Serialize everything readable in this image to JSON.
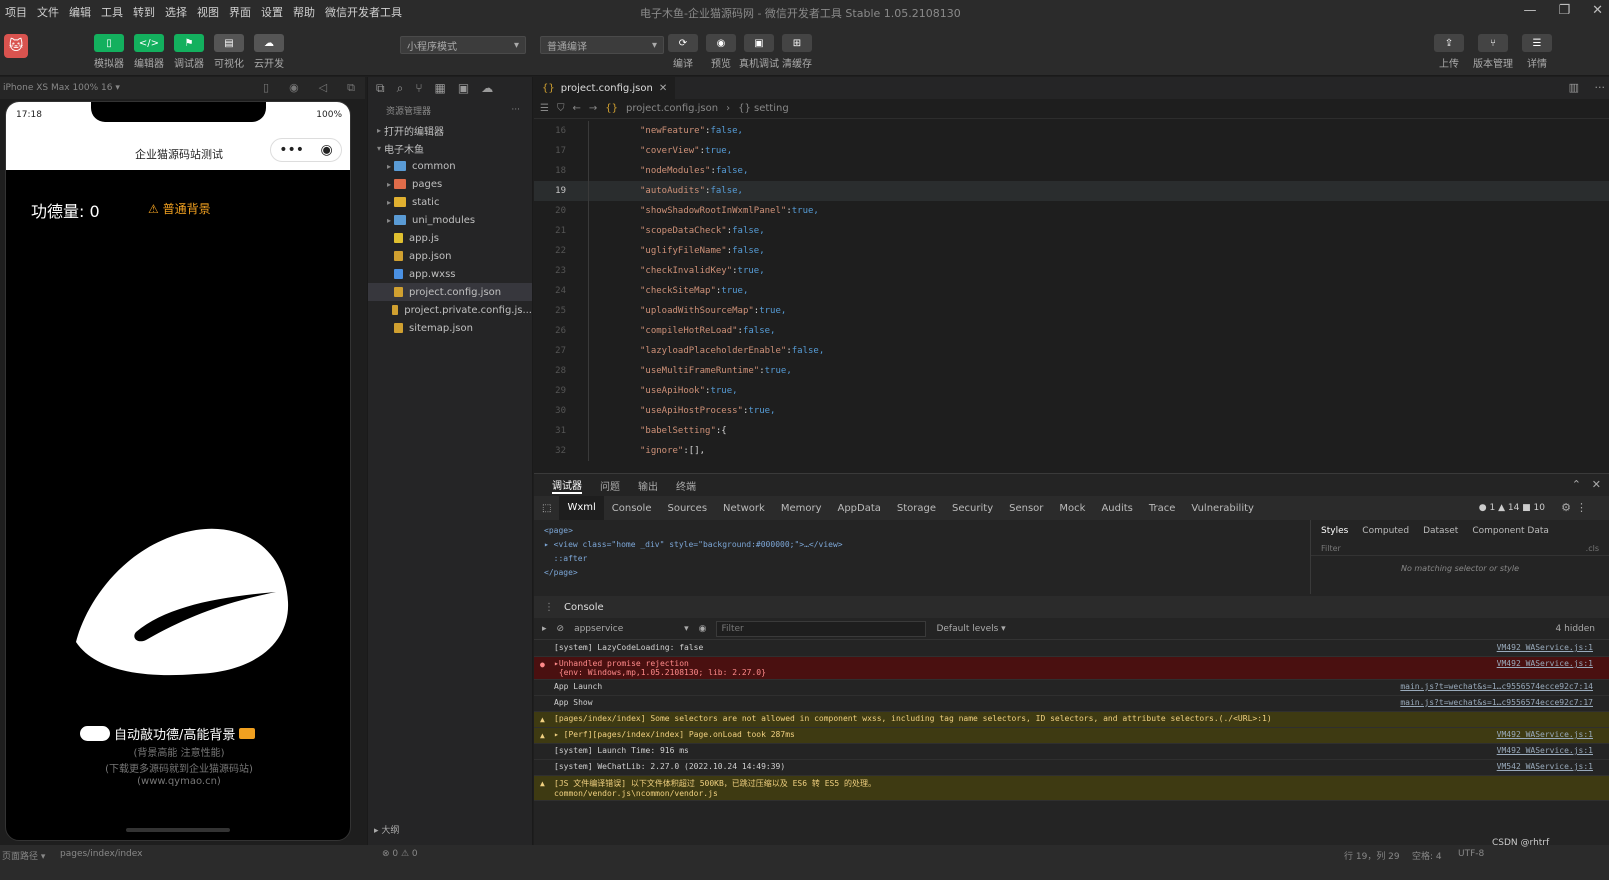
{
  "menubar": {
    "items": [
      "项目",
      "文件",
      "编辑",
      "工具",
      "转到",
      "选择",
      "视图",
      "界面",
      "设置",
      "帮助",
      "微信开发者工具"
    ],
    "window_title": "电子木鱼-企业猫源码网 - 微信开发者工具 Stable 1.05.2108130"
  },
  "toolbar": {
    "left_buttons": [
      {
        "label": "模拟器",
        "color": "#13b05e"
      },
      {
        "label": "编辑器",
        "color": "#13b05e"
      },
      {
        "label": "调试器",
        "color": "#13b05e"
      },
      {
        "label": "可视化",
        "color": "#555555"
      },
      {
        "label": "云开发",
        "color": "#555555"
      }
    ],
    "mode_select": "小程序模式",
    "compile_select": "普通编译",
    "mid_buttons": [
      "编译",
      "预览",
      "真机调试",
      "清缓存"
    ],
    "right_buttons": [
      "上传",
      "版本管理",
      "详情"
    ]
  },
  "simulator": {
    "device": "iPhone XS Max 100% 16 ▾",
    "time": "17:18",
    "battery": "100%",
    "page_title": "企业猫源码站测试",
    "merit": "功德量: 0",
    "warn_button": "⚠ 普通背景",
    "toggle_label": "自动敲功德/高能背景",
    "hints": [
      "(背景高能 注意性能)",
      "(下载更多源码就到企业猫源码站)",
      "(www.qymao.cn)"
    ]
  },
  "explorer": {
    "header": "资源管理器",
    "open_editors": "打开的编辑器",
    "project": "电子木鱼",
    "items": [
      {
        "name": "common",
        "type": "folder",
        "color": "#5a9bd5"
      },
      {
        "name": "pages",
        "type": "folder",
        "color": "#e06c4a"
      },
      {
        "name": "static",
        "type": "folder",
        "color": "#e0b030"
      },
      {
        "name": "uni_modules",
        "type": "folder",
        "color": "#5a9bd5"
      },
      {
        "name": "app.js",
        "type": "file",
        "color": "#e0c030"
      },
      {
        "name": "app.json",
        "type": "file",
        "color": "#d0a030"
      },
      {
        "name": "app.wxss",
        "type": "file",
        "color": "#4a90e2"
      },
      {
        "name": "project.config.json",
        "type": "file",
        "color": "#d0a030"
      },
      {
        "name": "project.private.config.js...",
        "type": "file",
        "color": "#d0a030"
      },
      {
        "name": "sitemap.json",
        "type": "file",
        "color": "#d0a030"
      }
    ],
    "outline": "大纲"
  },
  "editor": {
    "tab": "project.config.json",
    "breadcrumb": [
      "project.config.json",
      "{} setting"
    ],
    "lines": [
      {
        "n": "16",
        "key": "newFeature",
        "val": "false"
      },
      {
        "n": "17",
        "key": "coverView",
        "val": "true"
      },
      {
        "n": "18",
        "key": "nodeModules",
        "val": "false"
      },
      {
        "n": "19",
        "key": "autoAudits",
        "val": "false"
      },
      {
        "n": "20",
        "key": "showShadowRootInWxmlPanel",
        "val": "true"
      },
      {
        "n": "21",
        "key": "scopeDataCheck",
        "val": "false"
      },
      {
        "n": "22",
        "key": "uglifyFileName",
        "val": "false"
      },
      {
        "n": "23",
        "key": "checkInvalidKey",
        "val": "true"
      },
      {
        "n": "24",
        "key": "checkSiteMap",
        "val": "true"
      },
      {
        "n": "25",
        "key": "uploadWithSourceMap",
        "val": "true"
      },
      {
        "n": "26",
        "key": "compileHotReLoad",
        "val": "false"
      },
      {
        "n": "27",
        "key": "lazyloadPlaceholderEnable",
        "val": "false"
      },
      {
        "n": "28",
        "key": "useMultiFrameRuntime",
        "val": "true"
      },
      {
        "n": "29",
        "key": "useApiHook",
        "val": "true"
      },
      {
        "n": "30",
        "key": "useApiHostProcess",
        "val": "true"
      },
      {
        "n": "31",
        "key": "babelSetting",
        "val": "{"
      },
      {
        "n": "32",
        "key": "ignore",
        "val": "[],"
      }
    ]
  },
  "devtools": {
    "top_tabs": [
      "调试器",
      "问题",
      "输出",
      "终端"
    ],
    "tabs": [
      "Wxml",
      "Console",
      "Sources",
      "Network",
      "Memory",
      "AppData",
      "Storage",
      "Security",
      "Sensor",
      "Mock",
      "Audits",
      "Trace",
      "Vulnerability"
    ],
    "counts": "● 1 ▲ 14 ■ 10",
    "wxml_lines": [
      "<page>",
      "▸ <view class=\"home _div\" style=\"background:#000000;\">…</view>",
      "  ::after",
      "</page>"
    ],
    "style_tabs": [
      "Styles",
      "Computed",
      "Dataset",
      "Component Data"
    ],
    "style_filter": "Filter",
    "style_cls": ".cls",
    "no_match": "No matching selector or style",
    "console_label": "Console",
    "context": "appservice",
    "filter_placeholder": "Filter",
    "levels": "Default levels ▾",
    "hidden": "4 hidden",
    "logs": [
      {
        "type": "info",
        "msg": "[system] LazyCodeLoading: false",
        "src": "VM492 WAService.js:1"
      },
      {
        "type": "err",
        "msg": "▸Unhandled promise rejection\n {env: Windows,mp,1.05.2108130; lib: 2.27.0}",
        "src": "VM492 WAService.js:1"
      },
      {
        "type": "info",
        "msg": "App Launch",
        "src": "main.js?t=wechat&s=1…c9556574ecce92c7:14"
      },
      {
        "type": "info",
        "msg": "App Show",
        "src": "main.js?t=wechat&s=1…c9556574ecce92c7:17"
      },
      {
        "type": "warn",
        "msg": "[pages/index/index] Some selectors are not allowed in component wxss, including tag name selectors, ID selectors, and attribute selectors.(./<URL>:1)",
        "src": ""
      },
      {
        "type": "warn",
        "msg": "▸ [Perf][pages/index/index] Page.onLoad took 287ms",
        "src": "VM492 WAService.js:1"
      },
      {
        "type": "info",
        "msg": "[system] Launch Time: 916 ms",
        "src": "VM492 WAService.js:1"
      },
      {
        "type": "info",
        "msg": "[system] WeChatLib: 2.27.0 (2022.10.24 14:49:39)",
        "src": "VM542 WAService.js:1"
      },
      {
        "type": "warn",
        "msg": "[JS 文件编译错误] 以下文件体积超过 500KB，已跳过压缩以及 ES6 转 ES5 的处理。\ncommon/vendor.js\\ncommon/vendor.js",
        "src": ""
      }
    ]
  },
  "statusbar": {
    "path_label": "页面路径 ▾",
    "path": "pages/index/index",
    "problems": "⊗ 0 ⚠ 0",
    "cursor": "行 19，列 29",
    "spaces": "空格: 4",
    "encoding": "UTF-8",
    "watermark": "CSDN @rhtrf"
  }
}
